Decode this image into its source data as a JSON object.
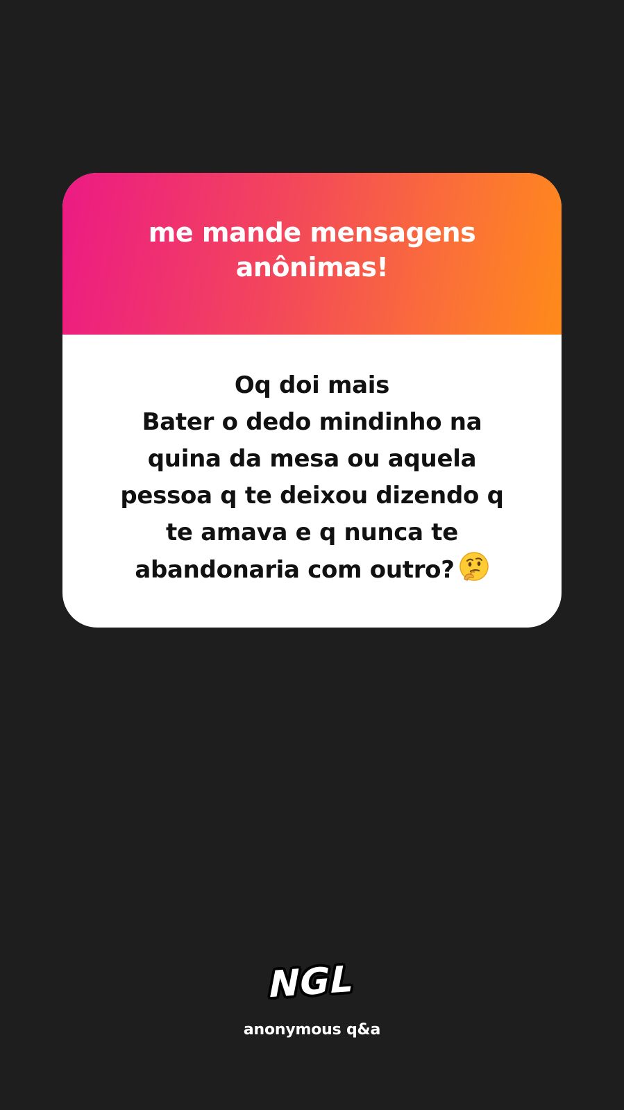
{
  "card": {
    "prompt": "me mande mensagens anônimas!",
    "message": "Oq doi mais\nBater o dedo mindinho na quina da mesa ou aquela pessoa q te deixou dizendo q te amava e q nunca te abandonaria com outro?",
    "emoji_icon": "thinking-face-icon"
  },
  "footer": {
    "logo": "NGL",
    "tagline": "anonymous q&a"
  },
  "colors": {
    "background": "#1e1e1e",
    "gradient_start": "#ec1a84",
    "gradient_end": "#ff8a1a",
    "card_body": "#ffffff"
  }
}
